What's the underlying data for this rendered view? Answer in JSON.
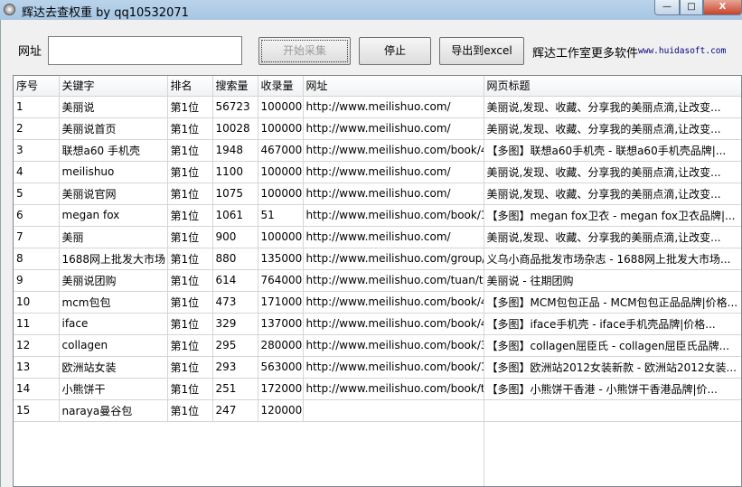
{
  "window": {
    "title": "辉达去查权重 by qq10532071",
    "minimize": "—",
    "maximize": "□",
    "close": "X"
  },
  "toolbar": {
    "url_label": "网址",
    "url_value": "",
    "start_label": "开始采集",
    "stop_label": "停止",
    "export_label": "导出到excel",
    "studio_text": "辉达工作室更多软件",
    "site_link": "www.huidasoft.com"
  },
  "table": {
    "columns": [
      "序号",
      "关键字",
      "排名",
      "搜索量",
      "收录量",
      "网址",
      "网页标题"
    ],
    "rows": [
      [
        "1",
        "美丽说",
        "第1位",
        "56723",
        "100000",
        "http://www.meilishuo.com/",
        "美丽说,发现、收藏、分享我的美丽点滴,让改变..."
      ],
      [
        "2",
        "美丽说首页",
        "第1位",
        "10028",
        "100000",
        "http://www.meilishuo.com/",
        "美丽说,发现、收藏、分享我的美丽点滴,让改变..."
      ],
      [
        "3",
        "联想a60 手机壳",
        "第1位",
        "1948",
        "467000",
        "http://www.meilishuo.com/book/4",
        "【多图】联想a60手机壳 - 联想a60手机壳品牌|..."
      ],
      [
        "4",
        "meilishuo",
        "第1位",
        "1100",
        "100000",
        "http://www.meilishuo.com/",
        "美丽说,发现、收藏、分享我的美丽点滴,让改变..."
      ],
      [
        "5",
        "美丽说官网",
        "第1位",
        "1075",
        "100000",
        "http://www.meilishuo.com/",
        "美丽说,发现、收藏、分享我的美丽点滴,让改变..."
      ],
      [
        "6",
        "megan fox",
        "第1位",
        "1061",
        "51",
        "http://www.meilishuo.com/book/1",
        "【多图】megan fox卫衣 - megan fox卫衣品牌|..."
      ],
      [
        "7",
        "美丽",
        "第1位",
        "900",
        "100000",
        "http://www.meilishuo.com/",
        "美丽说,发现、收藏、分享我的美丽点滴,让改变..."
      ],
      [
        "8",
        "1688网上批发大市场",
        "第1位",
        "880",
        "135000",
        "http://www.meilishuo.com/group/",
        "义乌小商品批发市场杂志 - 1688网上批发大市场..."
      ],
      [
        "9",
        "美丽说团购",
        "第1位",
        "614",
        "764000",
        "http://www.meilishuo.com/tuan/tu",
        "美丽说 - 往期团购"
      ],
      [
        "10",
        "mcm包包",
        "第1位",
        "473",
        "171000",
        "http://www.meilishuo.com/book/4",
        "【多图】MCM包包正品 - MCM包包正品品牌|价格..."
      ],
      [
        "11",
        "iface",
        "第1位",
        "329",
        "137000",
        "http://www.meilishuo.com/book/4",
        "【多图】iface手机壳 - iface手机壳品牌|价格..."
      ],
      [
        "12",
        "collagen",
        "第1位",
        "295",
        "280000",
        "http://www.meilishuo.com/book/3",
        "【多图】collagen屈臣氏 - collagen屈臣氏品牌..."
      ],
      [
        "13",
        "欧洲站女装",
        "第1位",
        "293",
        "563000",
        "http://www.meilishuo.com/book/1",
        "【多图】欧洲站2012女装新款 - 欧洲站2012女装..."
      ],
      [
        "14",
        "小熊饼干",
        "第1位",
        "251",
        "172000",
        "http://www.meilishuo.com/book/t",
        "【多图】小熊饼干香港 - 小熊饼干香港品牌|价..."
      ],
      [
        "15",
        "naraya曼谷包",
        "第1位",
        "247",
        "120000",
        "",
        ""
      ]
    ]
  }
}
